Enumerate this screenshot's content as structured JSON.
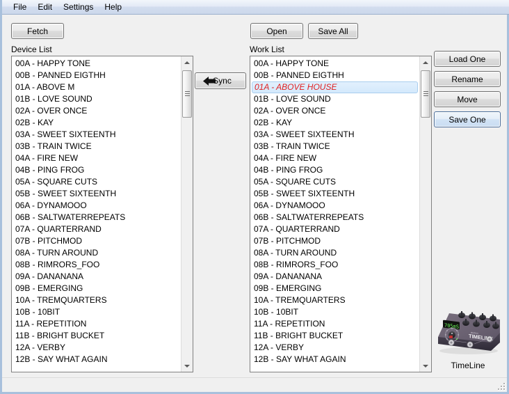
{
  "window": {
    "frame_color": "#a8c0dc",
    "background": "#f0f0f0"
  },
  "menubar": {
    "items": [
      {
        "label": "File"
      },
      {
        "label": "Edit"
      },
      {
        "label": "Settings"
      },
      {
        "label": "Help"
      }
    ]
  },
  "toolbar": {
    "fetch_label": "Fetch",
    "open_label": "Open",
    "save_all_label": "Save All",
    "sync_label": "Sync",
    "sync_icon": "arrow-left-icon"
  },
  "side_buttons": {
    "load_one_label": "Load One",
    "rename_label": "Rename",
    "move_label": "Move",
    "save_one_label": "Save One",
    "focused": "Save One"
  },
  "device_list": {
    "label": "Device List",
    "items": [
      "00A - HAPPY TONE",
      "00B - PANNED EIGTHH",
      "01A - ABOVE M",
      "01B - LOVE SOUND",
      "02A - OVER ONCE",
      "02B - KAY",
      "03A - SWEET SIXTEENTH",
      "03B - TRAIN TWICE",
      "04A - FIRE NEW",
      "04B - PING FROG",
      "05A - SQUARE CUTS",
      "05B - SWEET SIXTEENTH",
      "06A - DYNAMOOO",
      "06B - SALTWATERREPEATS",
      "07A - QUARTERRAND",
      "07B - PITCHMOD",
      "08A - TURN AROUND",
      "08B - RIMRORS_FOO",
      "09A - DANANANA",
      "09B - EMERGING",
      "10A - TREMQUARTERS",
      "10B - 10BIT",
      "11A - REPETITION",
      "11B - BRIGHT BUCKET",
      "12A - VERBY",
      "12B - SAY WHAT AGAIN"
    ],
    "selected_index": -1
  },
  "work_list": {
    "label": "Work List",
    "items": [
      "00A - HAPPY TONE",
      "00B - PANNED EIGTHH",
      "01A - ABOVE HOUSE",
      "01B - LOVE SOUND",
      "02A - OVER ONCE",
      "02B - KAY",
      "03A - SWEET SIXTEENTH",
      "03B - TRAIN TWICE",
      "04A - FIRE NEW",
      "04B - PING FROG",
      "05A - SQUARE CUTS",
      "05B - SWEET SIXTEENTH",
      "06A - DYNAMOOO",
      "06B - SALTWATERREPEATS",
      "07A - QUARTERRAND",
      "07B - PITCHMOD",
      "08A - TURN AROUND",
      "08B - RIMRORS_FOO",
      "09A - DANANANA",
      "09B - EMERGING",
      "10A - TREMQUARTERS",
      "10B - 10BIT",
      "11A - REPETITION",
      "11B - BRIGHT BUCKET",
      "12A - VERBY",
      "12B - SAY WHAT AGAIN"
    ],
    "selected_index": 2,
    "selected_text_color": "#e02020",
    "selected_background": "#d9ecfb"
  },
  "device": {
    "caption": "TimeLine",
    "display_text": "705mS",
    "brand_text": "strymon",
    "model_text": "TIMELINE"
  }
}
